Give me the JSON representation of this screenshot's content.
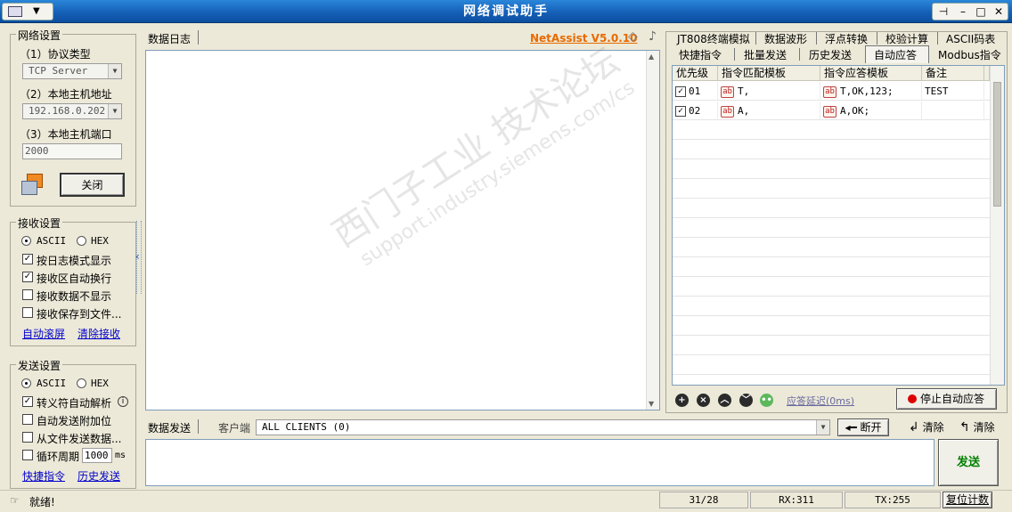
{
  "window": {
    "title": "网络调试助手"
  },
  "net_settings": {
    "title": "网络设置",
    "protocol_label": "（1）协议类型",
    "protocol_value": "TCP Server",
    "host_label": "（2）本地主机地址",
    "host_value": "192.168.0.202",
    "port_label": "（3）本地主机端口",
    "port_value": "2000",
    "close_button": "关闭"
  },
  "recv_settings": {
    "title": "接收设置",
    "ascii": "ASCII",
    "hex": "HEX",
    "opt_log_mode": "按日志模式显示",
    "opt_auto_wrap": "接收区自动换行",
    "opt_hide": "接收数据不显示",
    "opt_save_file": "接收保存到文件...",
    "link_autoscroll": "自动滚屏",
    "link_clear": "清除接收"
  },
  "send_settings": {
    "title": "发送设置",
    "ascii": "ASCII",
    "hex": "HEX",
    "opt_escape": "转义符自动解析",
    "opt_append_check": "自动发送附加位",
    "opt_from_file": "从文件发送数据...",
    "opt_cycle": "循环周期",
    "cycle_value": "1000",
    "cycle_unit": "ms",
    "link_quick": "快捷指令",
    "link_history": "历史发送"
  },
  "log": {
    "title": "数据日志",
    "version": "NetAssist V5.0.10"
  },
  "send": {
    "title": "数据发送",
    "client_label": "客户端",
    "client_value": "ALL CLIENTS (0)",
    "disconnect": "断开",
    "clear1": "清除",
    "clear2": "清除",
    "send_button": "发送"
  },
  "tabs_top": [
    "JT808终端模拟",
    "数据波形",
    "浮点转换",
    "校验计算",
    "ASCII码表"
  ],
  "tabs_bottom": [
    "快捷指令",
    "批量发送",
    "历史发送",
    "自动应答",
    "Modbus指令"
  ],
  "table": {
    "headers": [
      "优先级",
      "指令匹配模板",
      "指令应答模板",
      "备注"
    ],
    "rows": [
      {
        "priority": "01",
        "match": "T,",
        "reply": "T,OK,123;",
        "note": "TEST"
      },
      {
        "priority": "02",
        "match": "A,",
        "reply": "A,OK;",
        "note": ""
      }
    ]
  },
  "auto_reply": {
    "delay_link": "应答延迟(0ms)",
    "stop_button": "停止自动应答"
  },
  "status": {
    "ready": "就绪!",
    "count": "31/28",
    "rx": "RX:311",
    "tx": "TX:255",
    "reset": "复位计数"
  },
  "watermark": {
    "line1": "西门子工业 技术论坛",
    "line2": "support.industry.siemens.com/cs"
  },
  "colors": {
    "title_bar": "#1560b8",
    "version_text": "#e86a00",
    "send_text": "#008000",
    "stop_dot": "#dd0000"
  },
  "icons": [
    "diamond-icon",
    "bell-icon",
    "network-icon",
    "add-icon",
    "delete-icon",
    "up-icon",
    "down-icon",
    "chat-icon",
    "pin-icon"
  ]
}
